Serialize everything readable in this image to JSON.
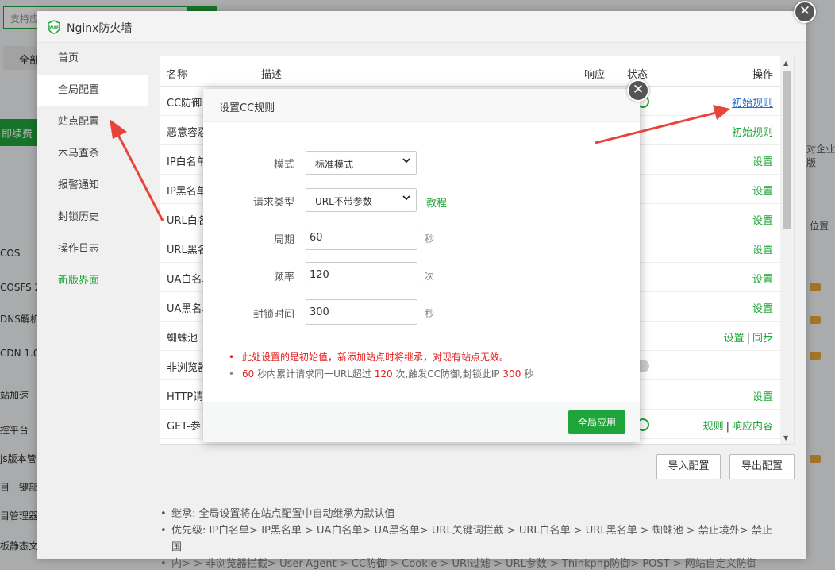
{
  "background": {
    "search_placeholder": "支持应",
    "tab_label": "全部",
    "renew_label": "即续费",
    "left_items": [
      "COS",
      "COSFS 2",
      "DNS解析",
      "CDN 1.0",
      "站加速",
      "控平台",
      "js版本管理",
      "目一键部",
      "目管理器",
      "板静态文"
    ],
    "right_texts": [
      "对企业版",
      "位置"
    ]
  },
  "window": {
    "title": "Nginx防火墙",
    "close_symbol": "✕"
  },
  "sidebar": {
    "items": [
      {
        "label": "首页"
      },
      {
        "label": "全局配置"
      },
      {
        "label": "站点配置"
      },
      {
        "label": "木马查杀"
      },
      {
        "label": "报警通知"
      },
      {
        "label": "封锁历史"
      },
      {
        "label": "操作日志"
      },
      {
        "label": "新版界面"
      }
    ]
  },
  "table": {
    "headers": {
      "name": "名称",
      "desc": "描述",
      "response": "响应",
      "status": "状态",
      "ops": "操作"
    },
    "rows": [
      {
        "name": "CC防御",
        "ops": "初始规则"
      },
      {
        "name": "恶意容忍",
        "ops": "初始规则"
      },
      {
        "name": "IP白名单",
        "ops": "设置"
      },
      {
        "name": "IP黑名单",
        "ops": "设置"
      },
      {
        "name": "URL白名单",
        "ops": "设置"
      },
      {
        "name": "URL黑名单",
        "ops": "设置"
      },
      {
        "name": "UA白名单",
        "ops": "设置"
      },
      {
        "name": "UA黑名单",
        "ops": "设置"
      },
      {
        "name": "蜘蛛池",
        "ops": "设置",
        "ops2": "同步"
      },
      {
        "name": "非浏览器",
        "ops": ""
      },
      {
        "name": "HTTP请",
        "ops": "设置"
      },
      {
        "name": "GET-参",
        "ops": "规则",
        "ops2": "响应内容"
      }
    ],
    "sep": "|"
  },
  "buttons": {
    "import": "导入配置",
    "export": "导出配置"
  },
  "notes": [
    "继承: 全局设置将在站点配置中自动继承为默认值",
    "优先级: IP白名单> IP黑名单 > UA白名单> UA黑名单> URL关键词拦截 > URL白名单 > URL黑名单 > 蜘蛛池 > 禁止境外> 禁止国",
    "内> > 非浏览器拦截> User-Agent > CC防御 > Cookie > URI过滤 > URL参数 > Thinkphp防御> POST > 网站自定义防御"
  ],
  "modal": {
    "title": "设置CC规则",
    "close_symbol": "✕",
    "mode_label": "模式",
    "mode_value": "标准模式",
    "reqtype_label": "请求类型",
    "reqtype_value": "URL不带参数",
    "tutorial_link": "教程",
    "period_label": "周期",
    "period_value": "60",
    "period_unit": "秒",
    "freq_label": "频率",
    "freq_value": "120",
    "freq_unit": "次",
    "block_label": "封锁时间",
    "block_value": "300",
    "block_unit": "秒",
    "warn_note": "此处设置的是初始值，新添加站点时将继承，对现有站点无效。",
    "info_note": {
      "p1": "60",
      "t1": " 秒内累计请求同一URL超过 ",
      "p2": "120",
      "t2": " 次,触发CC防御,封锁此IP ",
      "p3": "300",
      "t3": " 秒"
    },
    "apply_label": "全局应用"
  },
  "colors": {
    "brand_green": "#20a53a",
    "warn_red": "#e02020",
    "arrow_red": "#e8443a"
  }
}
